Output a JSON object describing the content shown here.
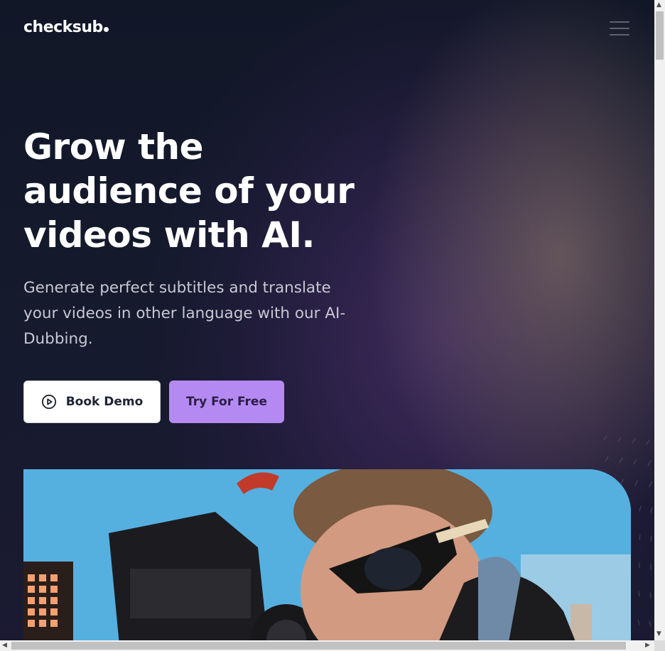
{
  "brand": {
    "logo_text": "checksub"
  },
  "header": {
    "menu_icon": "hamburger-menu-icon"
  },
  "hero": {
    "title": "Grow the audience of your videos with AI.",
    "subtitle": "Generate perfect subtitles and translate your videos in other language with our AI-Dubbing.",
    "book_demo_label": "Book Demo",
    "book_demo_icon": "play-circle-icon",
    "try_free_label": "Try For Free",
    "image_alt": "man filming with video camera"
  },
  "colors": {
    "background": "#111727",
    "accent": "#b48af2",
    "text_primary": "#ffffff",
    "text_secondary": "#c9c9d4"
  }
}
